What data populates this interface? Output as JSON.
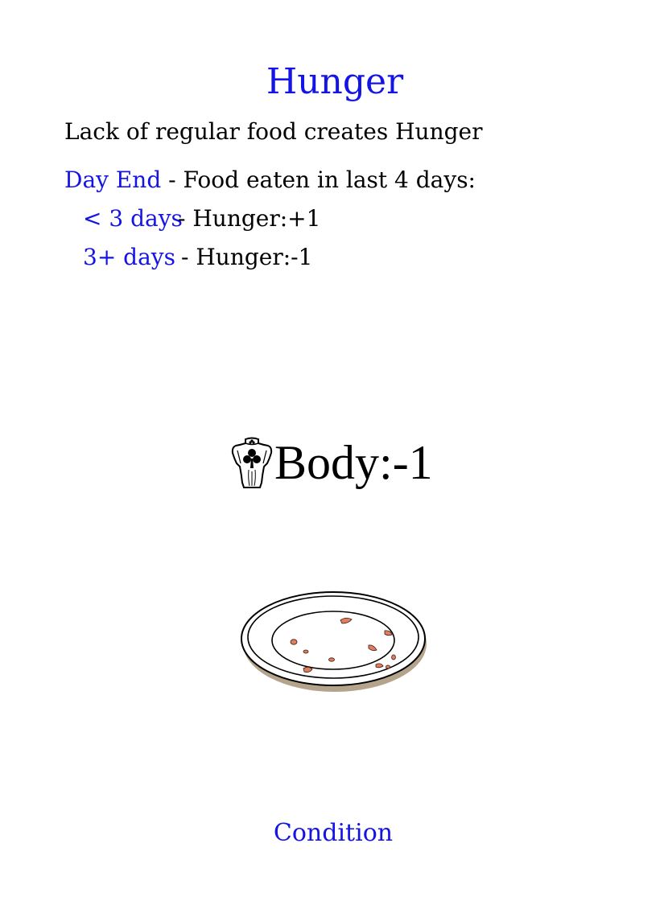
{
  "card": {
    "title": "Hunger",
    "intro": "Lack of regular food creates Hunger",
    "rule": {
      "trigger": "Day End",
      "description": " - Food eaten in last 4 days:",
      "rows": [
        {
          "condition": "< 3 days",
          "effect": "- Hunger:+1"
        },
        {
          "condition": "3+ days",
          "effect": "- Hunger:-1"
        }
      ]
    },
    "effect": {
      "icon": "body-bust-icon",
      "text": "Body:-1"
    },
    "illustration": "empty-plate-with-crumbs",
    "type": "Condition"
  },
  "colors": {
    "keyword": "#1414e6",
    "text": "#000000",
    "crumb": "#e07e5e",
    "plate_shadow": "#b5a48c"
  }
}
